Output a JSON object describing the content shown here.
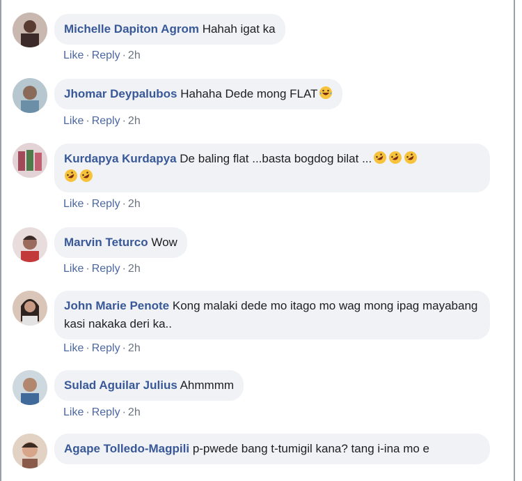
{
  "comments": [
    {
      "author": "Michelle Dapiton Agrom",
      "text": "Hahah igat ka",
      "like": "Like",
      "reply": "Reply",
      "time": "2h",
      "avatar_icon": "profile-photo"
    },
    {
      "author": "Jhomar Deypalubos",
      "text": "Hahaha Dede mong FLAT",
      "like": "Like",
      "reply": "Reply",
      "time": "2h",
      "emoji": "laughing-tears-emoji",
      "avatar_icon": "profile-photo"
    },
    {
      "author": "Kurdapya Kurdapya",
      "text": "De baling flat ...basta bogdog bilat ...",
      "like": "Like",
      "reply": "Reply",
      "time": "2h",
      "emoji": "rofl-emoji",
      "emoji_count": 5,
      "avatar_icon": "profile-photo"
    },
    {
      "author": "Marvin Teturco",
      "text": "Wow",
      "like": "Like",
      "reply": "Reply",
      "time": "2h",
      "avatar_icon": "profile-photo"
    },
    {
      "author": "John Marie Penote",
      "text": "Kong malaki dede mo itago mo wag mong ipag mayabang kasi nakaka deri ka..",
      "like": "Like",
      "reply": "Reply",
      "time": "2h",
      "avatar_icon": "profile-photo"
    },
    {
      "author": "Sulad Aguilar Julius",
      "text": "Ahmmmm",
      "like": "Like",
      "reply": "Reply",
      "time": "2h",
      "avatar_icon": "profile-photo"
    },
    {
      "author": "Agape Tolledo-Magpili",
      "text": "p-pwede bang t-tumigil kana? tang i-ina mo e",
      "avatar_icon": "profile-photo"
    }
  ],
  "colors": {
    "author": "#385898",
    "bubble": "#f0f2f5",
    "meta": "#6b7380"
  }
}
